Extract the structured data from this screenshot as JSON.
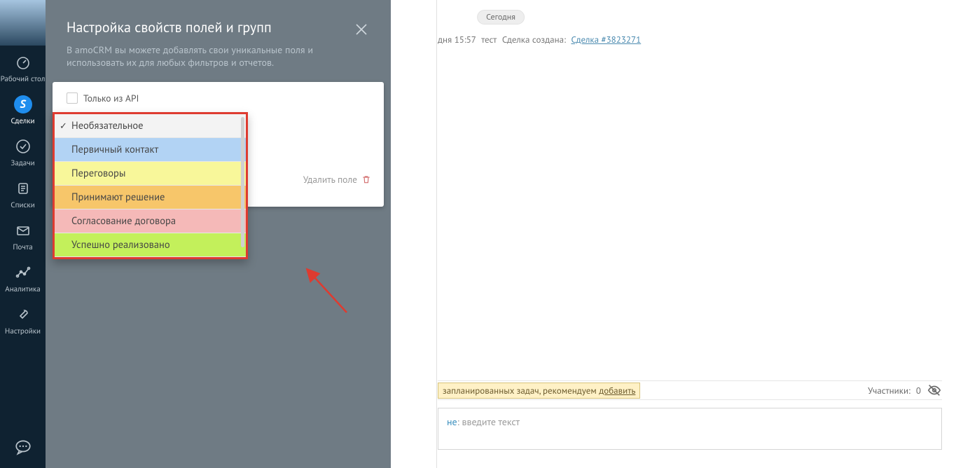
{
  "sidebar": {
    "items": [
      {
        "label": "Рабочий стол"
      },
      {
        "label": "Сделки",
        "letter": "S"
      },
      {
        "label": "Задачи"
      },
      {
        "label": "Списки"
      },
      {
        "label": "Почта"
      },
      {
        "label": "Аналитика"
      },
      {
        "label": "Настройки"
      }
    ]
  },
  "content": {
    "today": "Сегодня",
    "log": {
      "time": "дня 15:57",
      "user": "тест",
      "msg": "Сделка создана:",
      "link": "Сделка #3823271"
    },
    "task_warn_text": "запланированных задач, рекомендуем ",
    "task_warn_link": "добавить",
    "participants_label": "Участники:",
    "participants_count": "0",
    "note_prefix": "не",
    "note_placeholder": ": введите текст"
  },
  "modal": {
    "title": "Настройка свойств полей и групп",
    "subtitle": "В amoCRM вы можете добавлять свои уникальные поля и использовать их для любых фильтров и отчетов.",
    "api_only": "Только из API",
    "delete_field": "Удалить поле",
    "options": [
      {
        "label": "Необязательное",
        "cls": "b-gray",
        "selected": true
      },
      {
        "label": "Первичный контакт",
        "cls": "b-blue"
      },
      {
        "label": "Переговоры",
        "cls": "b-yellow"
      },
      {
        "label": "Принимают решение",
        "cls": "b-orange"
      },
      {
        "label": "Согласование договора",
        "cls": "b-pink"
      },
      {
        "label": "Успешно реализовано",
        "cls": "b-green"
      }
    ]
  }
}
